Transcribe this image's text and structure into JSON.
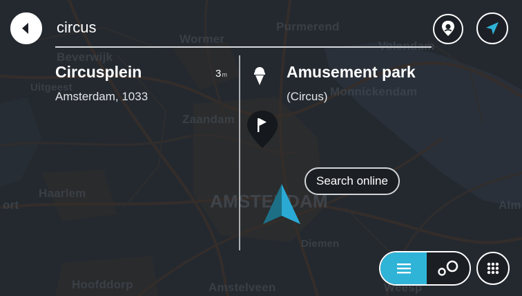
{
  "search": {
    "query": "circus"
  },
  "results": [
    {
      "title": "Circusplein",
      "subtitle": "Amsterdam, 1033",
      "distance_value": "3",
      "distance_unit": "m",
      "icon": "location"
    },
    {
      "title": "Amusement park",
      "subtitle": "(Circus)",
      "icon": "ice-cream-icon"
    }
  ],
  "buttons": {
    "search_online": "Search online"
  },
  "map_labels": {
    "wormer": "Wormer",
    "purmerend": "Purmerend",
    "volendam": "Volendam",
    "beverwijk": "Beverwijk",
    "uitgeest": "Uitgeest",
    "monnickendam": "Monnickendam",
    "zaandam": "Zaandam",
    "haarlem": "Haarlem",
    "amsterdam": "AMSTERDAM",
    "diemen": "Diemen",
    "hoofddorp": "Hoofddorp",
    "amstelveen": "Amstelveen",
    "weesp": "Weesp",
    "almere": "Alm",
    "port": "ort"
  },
  "icons": {
    "back": "back-arrow-icon",
    "pin": "location-pin-icon",
    "navigate": "navigation-arrow-icon",
    "list": "list-icon",
    "map": "map-view-icon",
    "keyboard": "keyboard-icon",
    "flag": "flag-marker-icon",
    "position": "current-position-icon"
  },
  "colors": {
    "accent": "#2fb4d8",
    "position_marker": "#2aa9d4",
    "background": "#2a2f36"
  }
}
